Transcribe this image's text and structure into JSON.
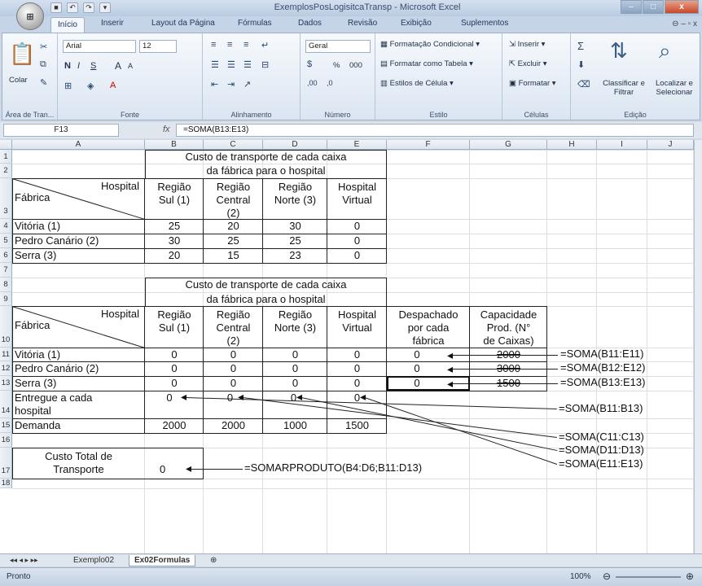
{
  "window": {
    "title": "ExemplosPosLogisitcaTransp - Microsoft Excel",
    "office_button": "Office",
    "min": "–",
    "max": "□",
    "close": "x"
  },
  "ribbon_tabs": [
    "Início",
    "Inserir",
    "Layout da Página",
    "Fórmulas",
    "Dados",
    "Revisão",
    "Exibição",
    "Suplementos"
  ],
  "ribbon_tab_controls": "⊖ – ▫ x",
  "ribbon": {
    "clipboard": {
      "paste": "Colar",
      "label": "Área de Tran..."
    },
    "font": {
      "name": "Arial",
      "size": "12",
      "bold": "N",
      "italic": "I",
      "underline": "S",
      "grow": "A",
      "shrink": "A",
      "label": "Fonte"
    },
    "alignment": {
      "label": "Alinhamento"
    },
    "number": {
      "format": "Geral",
      "percent": "%",
      "thousands": "000",
      "label": "Número"
    },
    "styles": {
      "conditional": "Formatação Condicional",
      "table": "Formatar como Tabela",
      "cell": "Estilos de Célula",
      "label": "Estilo"
    },
    "cells": {
      "insert": "Inserir",
      "delete": "Excluir",
      "format": "Formatar",
      "label": "Células"
    },
    "editing": {
      "sort": "Classificar e Filtrar",
      "find": "Localizar e Selecionar",
      "sigma": "Σ",
      "label": "Edição"
    }
  },
  "formula_bar": {
    "name_box": "F13",
    "fx": "fx",
    "formula": "=SOMA(B13:E13)"
  },
  "columns": [
    "A",
    "B",
    "C",
    "D",
    "E",
    "F",
    "G",
    "H",
    "I",
    "J"
  ],
  "rows": [
    "1",
    "2",
    "3",
    "4",
    "5",
    "6",
    "7",
    "8",
    "9",
    "10",
    "11",
    "12",
    "13",
    "14",
    "15",
    "16",
    "17",
    "18"
  ],
  "table1": {
    "title1": "Custo de transporte de cada caixa",
    "title2": "da fábrica para o hospital",
    "corner_top": "Hospital",
    "corner_bottom": "Fábrica",
    "headers": [
      [
        "Região",
        "Sul (1)"
      ],
      [
        "Região",
        "Central",
        "(2)"
      ],
      [
        "Região",
        "Norte (3)"
      ],
      [
        "Hospital",
        "Virtual"
      ]
    ],
    "rows": [
      {
        "label": "Vitória (1)",
        "values": [
          "25",
          "20",
          "30",
          "0"
        ]
      },
      {
        "label": "Pedro Canário (2)",
        "values": [
          "30",
          "25",
          "25",
          "0"
        ]
      },
      {
        "label": "Serra (3)",
        "values": [
          "20",
          "15",
          "23",
          "0"
        ]
      }
    ]
  },
  "table2": {
    "title1": "Custo de transporte de cada caixa",
    "title2": "da fábrica para o hospital",
    "corner_top": "Hospital",
    "corner_bottom": "Fábrica",
    "headers": [
      [
        "Região",
        "Sul (1)"
      ],
      [
        "Região",
        "Central",
        "(2)"
      ],
      [
        "Região",
        "Norte (3)"
      ],
      [
        "Hospital",
        "Virtual"
      ]
    ],
    "dispatched_header": [
      "Despachado",
      "por cada",
      "fábrica"
    ],
    "capacity_header": [
      "Capacidade",
      "Prod. (N°",
      "de Caixas)"
    ],
    "rows": [
      {
        "label": "Vitória (1)",
        "values": [
          "0",
          "0",
          "0",
          "0"
        ],
        "dispatched": "0",
        "capacity": "2000",
        "formula": "=SOMA(B11:E11)"
      },
      {
        "label": "Pedro Canário (2)",
        "values": [
          "0",
          "0",
          "0",
          "0"
        ],
        "dispatched": "0",
        "capacity": "3000",
        "formula": "=SOMA(B12:E12)"
      },
      {
        "label": "Serra (3)",
        "values": [
          "0",
          "0",
          "0",
          "0"
        ],
        "dispatched": "0",
        "capacity": "1500",
        "formula": "=SOMA(B13:E13)"
      }
    ],
    "delivered_label": [
      "Entregue a cada",
      "hospital"
    ],
    "delivered_values": [
      "0",
      "0",
      "0",
      "0"
    ],
    "demand_label": "Demanda",
    "demand_values": [
      "2000",
      "2000",
      "1000",
      "1500"
    ],
    "col_formulas": [
      "=SOMA(B11:B13)",
      "=SOMA(C11:C13)",
      "=SOMA(D11:D13)",
      "=SOMA(E11:E13)"
    ],
    "total_label": [
      "Custo Total de",
      "Transporte"
    ],
    "total_value": "0",
    "total_formula": "=SOMARPRODUTO(B4:D6;B11:D13)"
  },
  "sheets": [
    "Exemplo02",
    "Ex02Formulas"
  ],
  "status": {
    "text": "Pronto",
    "zoom": "100%"
  }
}
